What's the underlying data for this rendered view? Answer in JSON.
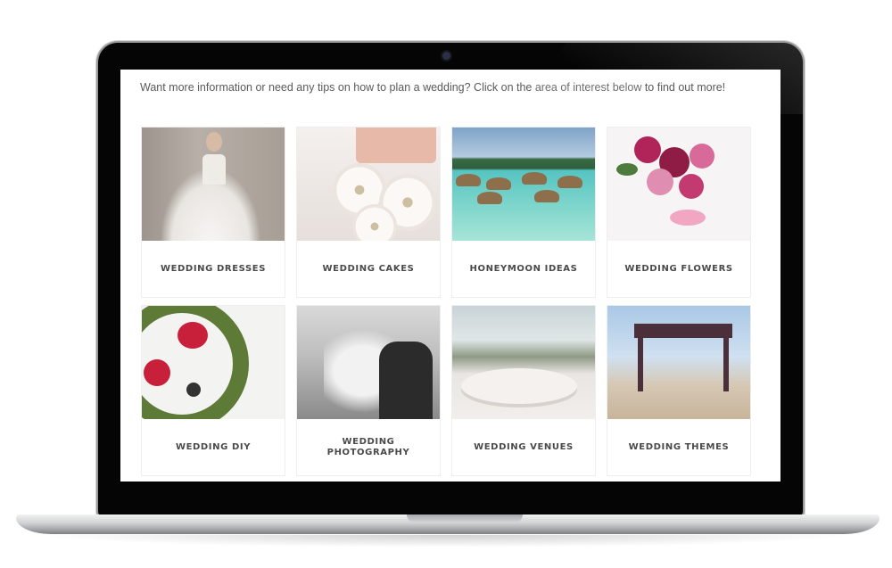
{
  "intro": {
    "text_before": "Want more information or need any tips on how to plan a wedding? Click on the ",
    "link_text": "area of interest below",
    "text_after": " to find out more!"
  },
  "accent_link_color": "#6f6f6f",
  "cards": [
    {
      "label": "WEDDING DRESSES"
    },
    {
      "label": "WEDDING CAKES"
    },
    {
      "label": "HONEYMOON IDEAS"
    },
    {
      "label": "WEDDING FLOWERS"
    },
    {
      "label": "WEDDING DIY"
    },
    {
      "label": "WEDDING PHOTOGRAPHY"
    },
    {
      "label": "WEDDING VENUES"
    },
    {
      "label": "WEDDING THEMES"
    }
  ]
}
